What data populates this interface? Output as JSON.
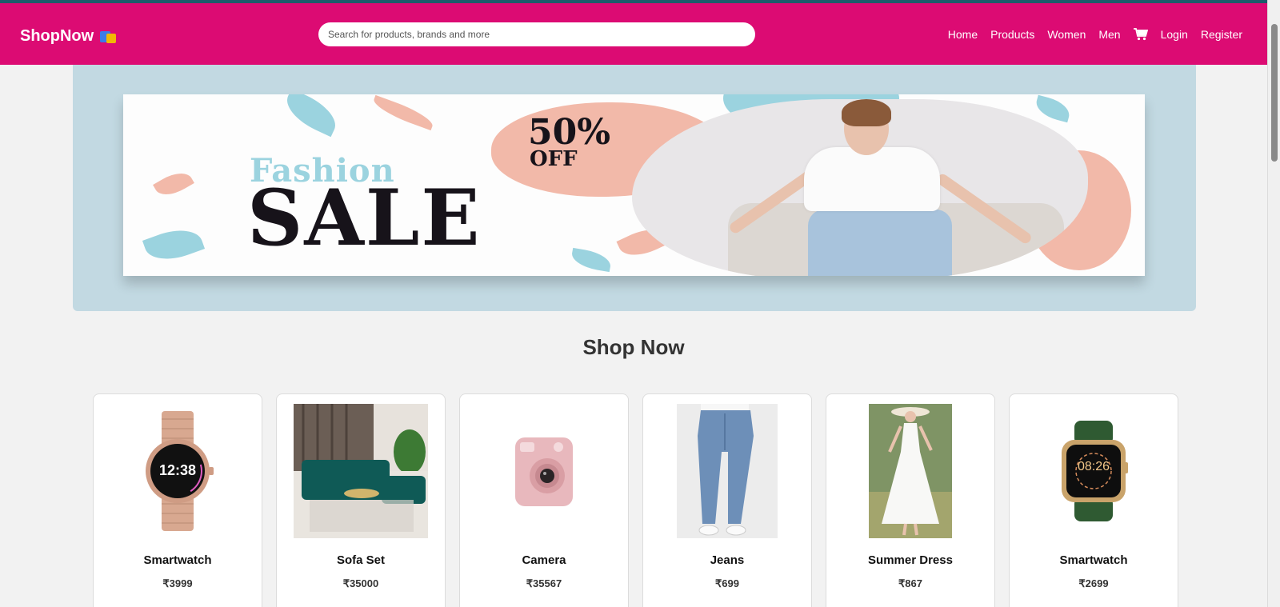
{
  "header": {
    "brand": "ShopNow",
    "brand_icon": "shopping-bags-icon",
    "search_placeholder": "Search for products, brands and more",
    "nav": [
      "Home",
      "Products",
      "Women",
      "Men",
      "Login",
      "Register"
    ],
    "cart_icon": "cart-icon",
    "bg_color": "#dc0b73"
  },
  "hero": {
    "word1": "Fashion",
    "word2": "SALE",
    "percent": "50%",
    "off": "OFF",
    "bg_color": "#c2d9e2"
  },
  "section_title": "Shop Now",
  "products": [
    {
      "name": "Smartwatch",
      "price": "₹3999",
      "icon": "rose-gold-smartwatch"
    },
    {
      "name": "Sofa Set",
      "price": "₹35000",
      "icon": "green-sofa"
    },
    {
      "name": "Camera",
      "price": "₹35567",
      "icon": "pink-instant-camera"
    },
    {
      "name": "Jeans",
      "price": "₹699",
      "icon": "blue-jeans"
    },
    {
      "name": "Summer Dress",
      "price": "₹867",
      "icon": "white-dress"
    },
    {
      "name": "Smartwatch",
      "price": "₹2699",
      "icon": "green-strap-smartwatch"
    }
  ]
}
